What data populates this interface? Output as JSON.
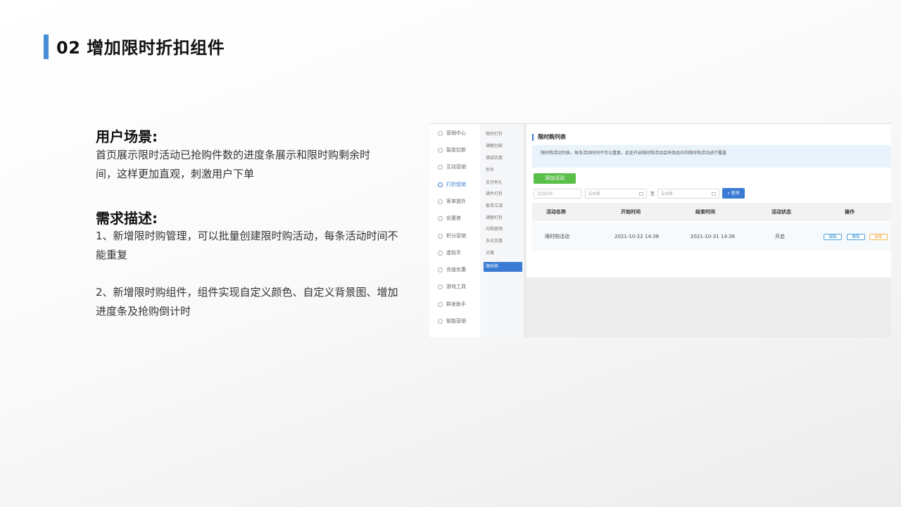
{
  "slide": {
    "title": "02 增加限时折扣组件"
  },
  "scene": {
    "heading": "用户场景:",
    "lines": [
      "首页展示限时活动已抢购件数的进度条展示和限时购剩余时",
      "间，这样更加直观，刺激用户下单"
    ]
  },
  "requirements": {
    "heading": "需求描述:",
    "item1": [
      "1、新增限时购管理，可以批量创建限时购活动，每条活动时间不",
      "能重复"
    ],
    "item2": [
      "2、新增限时购组件，组件实现自定义颜色、自定义背景图、增加",
      "进度条及抢购倒计时"
    ]
  },
  "screenshot": {
    "nav": [
      "营销中心",
      "裂变拉新",
      "互动营销",
      "打折促销",
      "客单提升",
      "优惠券",
      "积分营销",
      "虚拟币",
      "充值优惠",
      "游戏工具",
      "群发助手",
      "智能营销"
    ],
    "nav_active_index": 3,
    "subnav": [
      "限时打折",
      "满额包邮",
      "满减优惠",
      "秒杀",
      "支付有礼",
      "满件打折",
      "套单立减",
      "满额打折",
      "内购营销",
      "多买优惠",
      "买赠",
      "限时购"
    ],
    "subnav_active_index": 11,
    "title": "限时购列表",
    "notice": "限时购活动列表，每条活动时间不可以重复。此处开启限时购活动会将商品中的限时购活动进行覆盖",
    "add_button": "添加活动",
    "filters": {
      "name_placeholder": "活动名称",
      "start_placeholder": "有效期",
      "to": "至",
      "end_placeholder": "有效期",
      "query_button": "查询"
    },
    "table": {
      "headers": [
        "活动名称",
        "开始时间",
        "结束时间",
        "活动状态",
        "操作"
      ],
      "rows": [
        {
          "name": "限时购活动",
          "start": "2021-10-22 14:38",
          "end": "2021-10-31 14:38",
          "status": "开启"
        }
      ],
      "actions": [
        "编辑",
        "删除",
        "结束"
      ]
    },
    "colors": {
      "accent": "#3a7bd5",
      "add_button": "#5bc04a",
      "notice_bg": "#e8f3fc",
      "end_action": "#f0a030"
    }
  }
}
